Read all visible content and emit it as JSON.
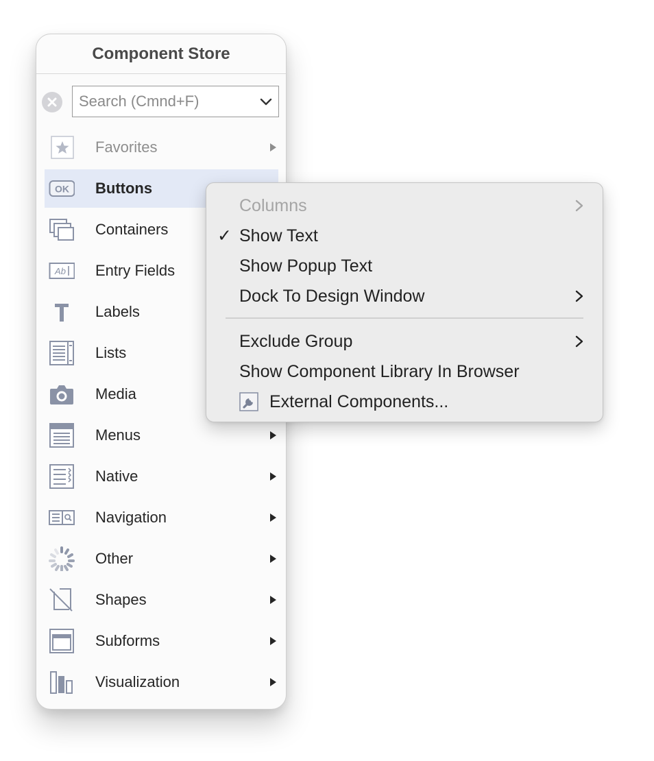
{
  "panel": {
    "title": "Component Store",
    "search": {
      "placeholder": "Search (Cmnd+F)",
      "value": ""
    },
    "items": [
      {
        "label": "Favorites",
        "icon": "star-icon",
        "disabled": true
      },
      {
        "label": "Buttons",
        "icon": "ok-button-icon",
        "selected": true
      },
      {
        "label": "Containers",
        "icon": "containers-icon"
      },
      {
        "label": "Entry Fields",
        "icon": "text-field-icon"
      },
      {
        "label": "Labels",
        "icon": "text-t-icon"
      },
      {
        "label": "Lists",
        "icon": "list-icon"
      },
      {
        "label": "Media",
        "icon": "camera-icon"
      },
      {
        "label": "Menus",
        "icon": "menu-icon"
      },
      {
        "label": "Native",
        "icon": "native-icon"
      },
      {
        "label": "Navigation",
        "icon": "navigation-icon"
      },
      {
        "label": "Other",
        "icon": "spinner-icon"
      },
      {
        "label": "Shapes",
        "icon": "shapes-icon"
      },
      {
        "label": "Subforms",
        "icon": "subform-icon"
      },
      {
        "label": "Visualization",
        "icon": "bar-chart-icon"
      }
    ]
  },
  "context_menu": {
    "items": [
      {
        "label": "Columns",
        "disabled": true,
        "submenu": true
      },
      {
        "label": "Show Text",
        "checked": true
      },
      {
        "label": "Show Popup Text"
      },
      {
        "label": "Dock To Design Window",
        "submenu": true
      },
      {
        "label": "Exclude Group",
        "submenu": true
      },
      {
        "label": "Show Component Library In Browser"
      },
      {
        "label": "External Components...",
        "icon": "wrench-icon"
      }
    ],
    "check_glyph": "✓"
  },
  "colors": {
    "icon": "#8a92a6",
    "selected_row": "#e3e9f6",
    "menu_bg": "#ececec"
  }
}
